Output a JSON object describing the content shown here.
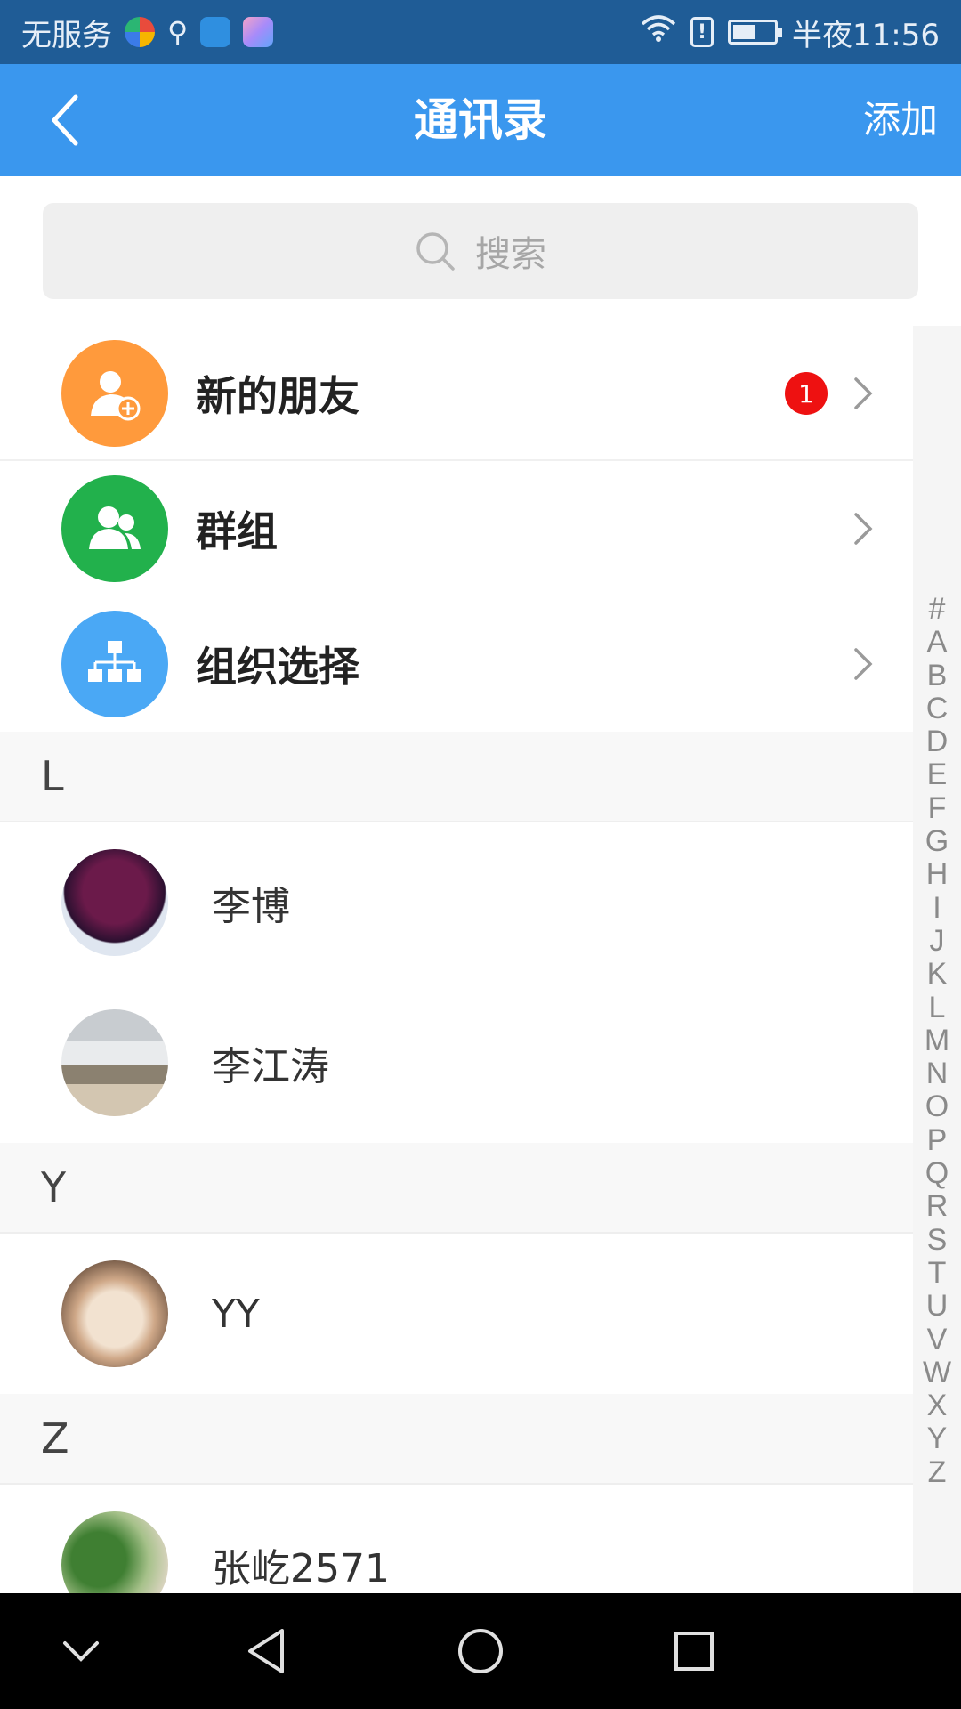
{
  "status_bar": {
    "carrier": "无服务",
    "time": "半夜11:56",
    "battery_level": 0.55
  },
  "header": {
    "title": "通讯录",
    "add_label": "添加",
    "background_color": "#3a97ee"
  },
  "search": {
    "placeholder": "搜索"
  },
  "functions": [
    {
      "label": "新的朋友",
      "icon": "add-friend-icon",
      "color": "#ff9a3c",
      "badge": "1"
    },
    {
      "label": "群组",
      "icon": "group-icon",
      "color": "#22b14c"
    },
    {
      "label": "组织选择",
      "icon": "org-chart-icon",
      "color": "#4aa8f5"
    }
  ],
  "sections": [
    {
      "letter": "L",
      "contacts": [
        {
          "name": "李博"
        },
        {
          "name": "李江涛"
        }
      ]
    },
    {
      "letter": "Y",
      "contacts": [
        {
          "name": "YY"
        }
      ]
    },
    {
      "letter": "Z",
      "contacts": [
        {
          "name": "张屹2571"
        }
      ]
    }
  ],
  "index_letters": [
    "#",
    "A",
    "B",
    "C",
    "D",
    "E",
    "F",
    "G",
    "H",
    "I",
    "J",
    "K",
    "L",
    "M",
    "N",
    "O",
    "P",
    "Q",
    "R",
    "S",
    "T",
    "U",
    "V",
    "W",
    "X",
    "Y",
    "Z"
  ],
  "badge_color": "#ee1111"
}
